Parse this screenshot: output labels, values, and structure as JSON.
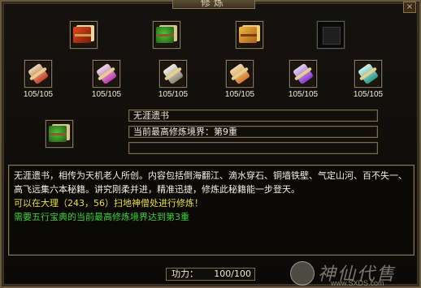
{
  "window": {
    "title": "修炼",
    "close": "×"
  },
  "top_slots": [
    {
      "icon": "red-gold-book-icon",
      "color": "#d23a1a"
    },
    {
      "icon": "green-orb-book-icon",
      "color": "#3a9a2a"
    },
    {
      "icon": "gold-treasure-book-icon",
      "color": "#d8a01a"
    },
    {
      "icon": "empty-slot-icon",
      "color": "#222222"
    }
  ],
  "scrolls": [
    {
      "icon": "red-scroll-icon",
      "color": "#c8402a",
      "count": "105/105"
    },
    {
      "icon": "magenta-scroll-icon",
      "color": "#c03ab0",
      "count": "105/105"
    },
    {
      "icon": "gray-scroll-icon",
      "color": "#b8b0a0",
      "count": "105/105"
    },
    {
      "icon": "orange-scroll-icon",
      "color": "#d8782a",
      "count": "105/105"
    },
    {
      "icon": "purple-scroll-icon",
      "color": "#8a3ad0",
      "count": "105/105"
    },
    {
      "icon": "teal-scroll-icon",
      "color": "#2a9a8a",
      "count": "105/105"
    }
  ],
  "selected_item": {
    "icon": "green-orb-book-icon",
    "color": "#3a9a2a"
  },
  "info": {
    "name": "无涯遗书",
    "level_line": "当前最高修炼境界：第9重",
    "extra": ""
  },
  "description": {
    "body": "无涯遗书，相传为天机老人所创。内容包括倒海翻江、滴水穿石、铜墙铁壁、气定山河、百不失一、高飞远集六本秘籍。讲究刚柔并进，精准迅捷，修炼此秘籍能一步登天。",
    "location": "可以在大理（243，56）扫地神僧处进行修炼！",
    "requirement": "需要五行宝典的当前最高修炼境界达到第3重"
  },
  "power": {
    "label": "功力：",
    "value": "100/100"
  },
  "watermark": {
    "text": "神仙代售",
    "url": "www.SXDS.com"
  }
}
